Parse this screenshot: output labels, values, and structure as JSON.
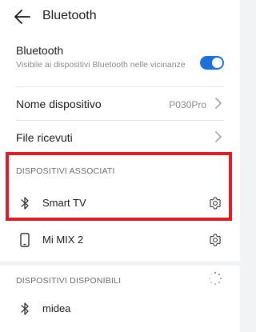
{
  "header": {
    "title": "Bluetooth",
    "back_icon": "arrow-left-icon"
  },
  "bluetooth_toggle": {
    "label": "Bluetooth",
    "description": "Visibile ai dispositivi Bluetooth nelle vicinanze",
    "enabled": true,
    "accent_color": "#1e6fd9"
  },
  "device_name_row": {
    "label": "Nome dispositivo",
    "value": "P030Pro"
  },
  "received_files_row": {
    "label": "File ricevuti"
  },
  "paired_section": {
    "header": "DISPOSITIVI ASSOCIATI",
    "devices": [
      {
        "name": "Smart TV",
        "icon": "bluetooth-icon"
      },
      {
        "name": "Mi MIX 2",
        "icon": "phone-icon"
      }
    ],
    "highlight_color": "#e01b24"
  },
  "available_section": {
    "header": "DISPOSITIVI DISPONIBILI",
    "loading": true,
    "devices": [
      {
        "name": "midea",
        "icon": "bluetooth-icon"
      }
    ]
  }
}
